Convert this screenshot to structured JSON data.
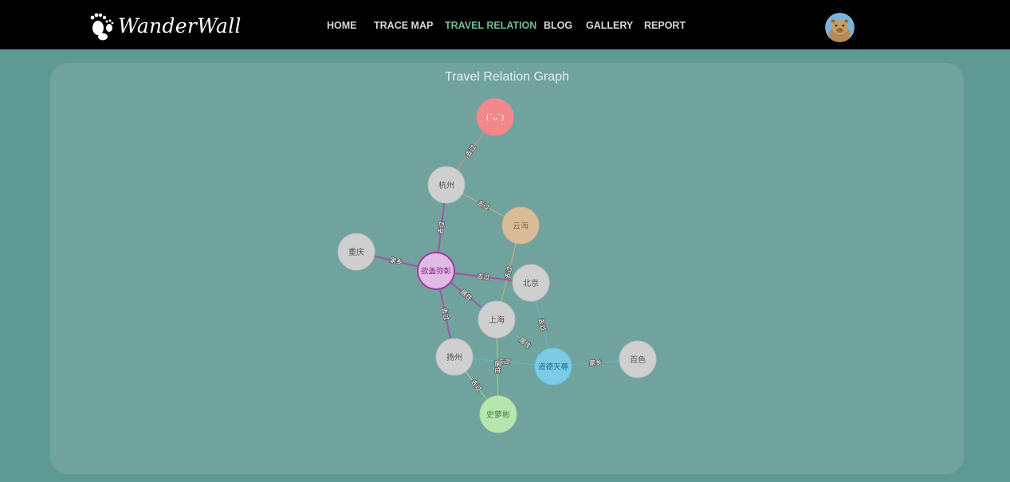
{
  "header": {
    "brand_name": "WanderWall",
    "brand_icon": "footprints-icon",
    "avatar_icon": "capybara-avatar-icon"
  },
  "nav": {
    "items": [
      {
        "label": "HOME",
        "active": false
      },
      {
        "label": "TRACE MAP",
        "active": false
      },
      {
        "label": "TRAVEL RELATION",
        "active": true
      },
      {
        "label": "BLOG",
        "active": false
      },
      {
        "label": "GALLERY",
        "active": false
      },
      {
        "label": "REPORT",
        "active": false
      }
    ],
    "active_color": "#6fbf8e"
  },
  "graph": {
    "title": "Travel Relation Graph",
    "nodes": [
      {
        "id": "top",
        "label": "(ˊᴗˋ)",
        "type": "user-red",
        "fill": "#f2888b",
        "stroke": "#f2888b",
        "text": "#ffffff"
      },
      {
        "id": "hangzhou",
        "label": "杭州",
        "type": "city",
        "fill": "#cfcfcf",
        "stroke": "#bdbdbd",
        "text": "#555555"
      },
      {
        "id": "yunhai",
        "label": "云海",
        "type": "user-tan",
        "fill": "#d9bc97",
        "stroke": "#d0b089",
        "text": "#8a6f4e"
      },
      {
        "id": "chongqing",
        "label": "重庆",
        "type": "city",
        "fill": "#cfcfcf",
        "stroke": "#bdbdbd",
        "text": "#555555"
      },
      {
        "id": "center",
        "label": "欲盖弥彰",
        "type": "user-purple",
        "fill": "#e3b9e6",
        "stroke": "#9b3fa1",
        "text": "#7a2f80"
      },
      {
        "id": "beijing",
        "label": "北京",
        "type": "city",
        "fill": "#cfcfcf",
        "stroke": "#bdbdbd",
        "text": "#555555"
      },
      {
        "id": "shanghai",
        "label": "上海",
        "type": "city",
        "fill": "#cfcfcf",
        "stroke": "#bdbdbd",
        "text": "#555555"
      },
      {
        "id": "yangzhou",
        "label": "扬州",
        "type": "city",
        "fill": "#cfcfcf",
        "stroke": "#bdbdbd",
        "text": "#555555"
      },
      {
        "id": "daode",
        "label": "道德天尊",
        "type": "user-blue",
        "fill": "#79cbe6",
        "stroke": "#69bedb",
        "text": "#2a6b84"
      },
      {
        "id": "baise",
        "label": "百色",
        "type": "city",
        "fill": "#cfcfcf",
        "stroke": "#bdbdbd",
        "text": "#555555"
      },
      {
        "id": "shimeng",
        "label": "史萝彬",
        "type": "user-green",
        "fill": "#b6e6ad",
        "stroke": "#a7dc9d",
        "text": "#4f7a48"
      }
    ],
    "edges": [
      {
        "source": "top",
        "target": "hangzhou",
        "label": "去过",
        "color": "#e38a88"
      },
      {
        "source": "yunhai",
        "target": "hangzhou",
        "label": "去过",
        "color": "#c9ad86"
      },
      {
        "source": "yunhai",
        "target": "shanghai",
        "label": "去过",
        "color": "#c9ad86"
      },
      {
        "source": "center",
        "target": "hangzhou",
        "label": "去过",
        "color": "#a054a6"
      },
      {
        "source": "center",
        "target": "chongqing",
        "label": "家乡",
        "color": "#a054a6"
      },
      {
        "source": "center",
        "target": "beijing",
        "label": "去过",
        "color": "#a054a6"
      },
      {
        "source": "center",
        "target": "shanghai",
        "label": "居住",
        "color": "#a054a6"
      },
      {
        "source": "center",
        "target": "yangzhou",
        "label": "去过",
        "color": "#a054a6"
      },
      {
        "source": "daode",
        "target": "beijing",
        "label": "去过",
        "color": "#5fb6cf"
      },
      {
        "source": "daode",
        "target": "shanghai",
        "label": "居住",
        "color": "#5fb6cf"
      },
      {
        "source": "daode",
        "target": "yangzhou",
        "label": "去过",
        "color": "#5fb6cf"
      },
      {
        "source": "daode",
        "target": "baise",
        "label": "家乡",
        "color": "#5fb6cf"
      },
      {
        "source": "shimeng",
        "target": "shanghai",
        "label": "居住",
        "color": "#9dcf93"
      },
      {
        "source": "shimeng",
        "target": "yangzhou",
        "label": "去过",
        "color": "#9dcf93"
      }
    ]
  }
}
